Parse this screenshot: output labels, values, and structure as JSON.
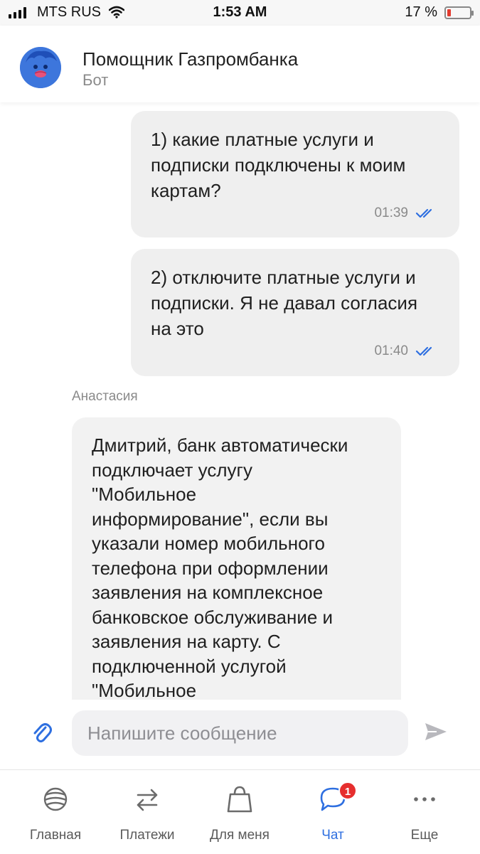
{
  "status_bar": {
    "carrier": "MTS RUS",
    "time": "1:53 AM",
    "battery": "17 %"
  },
  "header": {
    "title": "Помощник Газпромбанка",
    "subtitle": "Бот"
  },
  "messages": [
    {
      "direction": "outgoing",
      "lines": [
        "1) какие платные услуги и",
        "подписки подключены к моим",
        "картам?"
      ],
      "time": "01:39",
      "status_icon": "double-check-icon"
    },
    {
      "direction": "outgoing",
      "lines": [
        "2) отключите платные услуги и",
        "подписки. Я не давал согласия",
        "на это"
      ],
      "time": "01:40",
      "status_icon": "double-check-icon"
    },
    {
      "direction": "incoming",
      "sender": "Анастасия",
      "lines": [
        "Дмитрий, банк автоматически",
        "подключает услугу",
        "\"Мобильное",
        "информирование\", если вы",
        "указали номер мобильного",
        "телефона при оформлении",
        "заявления на комплексное",
        "банковское обслуживание и",
        "заявления на карту. С",
        "подключенной услугой",
        "\"Мобильное"
      ]
    }
  ],
  "composer": {
    "placeholder": "Напишите сообщение",
    "attach_icon": "paperclip-icon",
    "send_icon": "send-icon"
  },
  "tabbar": {
    "items": [
      {
        "label": "Главная",
        "icon": "home-logo-icon",
        "active": false
      },
      {
        "label": "Платежи",
        "icon": "transfer-arrows-icon",
        "active": false
      },
      {
        "label": "Для меня",
        "icon": "shopping-bag-icon",
        "active": false
      },
      {
        "label": "Чат",
        "icon": "chat-bubble-icon",
        "active": true,
        "badge": "1"
      },
      {
        "label": "Еще",
        "icon": "more-dots-icon",
        "active": false
      }
    ]
  },
  "colors": {
    "accent": "#2e6fe0",
    "badge": "#e62e2e",
    "bubble": "#efefef"
  }
}
